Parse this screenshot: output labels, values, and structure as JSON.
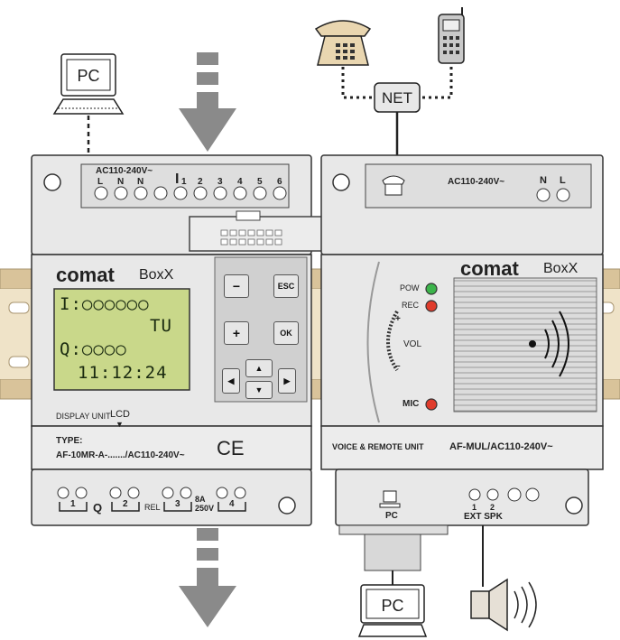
{
  "diagram_title": "",
  "net": {
    "label": "NET"
  },
  "pc_top": {
    "label": "PC"
  },
  "pc_bottom": {
    "label": "PC"
  },
  "plc": {
    "brand": "comat",
    "model": "BoxX",
    "power_label": "AC110-240V~",
    "terminals": [
      "L",
      "N",
      "N"
    ],
    "input_label": "I",
    "input_numbers": [
      "1",
      "2",
      "3",
      "4",
      "5",
      "6"
    ],
    "lcd_lines": [
      "I:○○○○○○",
      "TU",
      "Q:○○○○",
      "11:12:24"
    ],
    "display_label": "DISPLAY UNIT",
    "lcd_label": "LCD",
    "keys": {
      "minus": "−",
      "esc": "ESC",
      "plus": "+",
      "ok": "OK"
    },
    "type_label": "TYPE:",
    "type_value": "AF-10MR-A-......./AC110-240V~",
    "ce": "CE",
    "outputs": [
      "1",
      "2",
      "3",
      "4"
    ],
    "q_label": "Q",
    "rel_label": "REL",
    "rating": "8A\n250V"
  },
  "voice": {
    "brand": "comat",
    "model": "BoxX",
    "power_label": "AC110-240V~",
    "terminals": [
      "N",
      "L"
    ],
    "pow": "POW",
    "rec": "REC",
    "vol": "VOL",
    "plus": "+",
    "minus": "–",
    "mic": "MIC",
    "unit_label": "VOICE & REMOTE UNIT",
    "model_code": "AF-MUL/AC110-240V~",
    "pc_port": "PC",
    "ext": "EXT SPK",
    "ext_numbers": [
      "1",
      "2"
    ]
  },
  "colors": {
    "led_green": "#3cb44b",
    "led_red": "#e03c2c",
    "lcd": "#c9d88a",
    "arrow": "#8a8a8a",
    "body": "#e8e8e8",
    "rail": "#d9c39a"
  }
}
